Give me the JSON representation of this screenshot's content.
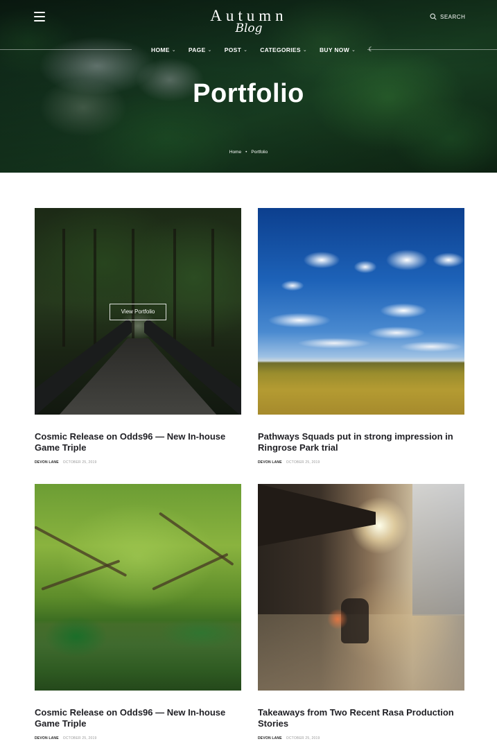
{
  "header": {
    "logo_top": "Autumn",
    "logo_script": "Blog",
    "search_label": "SEARCH",
    "nav": [
      {
        "label": "HOME"
      },
      {
        "label": "PAGE"
      },
      {
        "label": "POST"
      },
      {
        "label": "CATEGORIES"
      },
      {
        "label": "BUY NOW"
      }
    ]
  },
  "hero": {
    "title": "Portfolio",
    "breadcrumb": {
      "home": "Home",
      "separator": "•",
      "current": "Portfolio"
    }
  },
  "overlay_button": "View Portfolio",
  "posts": [
    {
      "title": "Cosmic Release on Odds96 — New In-house Game Triple",
      "author": "DEVON LANE",
      "date": "OCTOBER 25, 2019",
      "image": "forest-bridge"
    },
    {
      "title": "Pathways Squads put in strong impression in Ringrose Park trial",
      "author": "DEVON LANE",
      "date": "OCTOBER 25, 2019",
      "image": "sky-field"
    },
    {
      "title": "Cosmic Release on Odds96 — New In-house Game Triple",
      "author": "DEVON LANE",
      "date": "OCTOBER 25, 2019",
      "image": "mangrove-river"
    },
    {
      "title": "Takeaways from Two Recent Rasa Production Stories",
      "author": "DEVON LANE",
      "date": "OCTOBER 25, 2019",
      "image": "sunny-street"
    }
  ],
  "colors": {
    "title_text": "#1f1f24",
    "meta_date": "#999999",
    "background": "#ffffff"
  }
}
